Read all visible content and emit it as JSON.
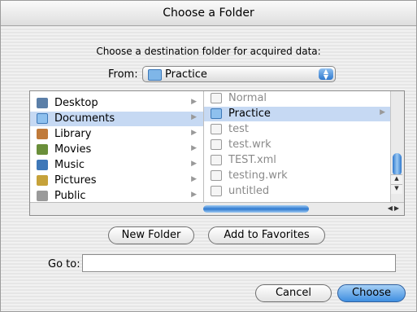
{
  "window": {
    "title": "Choose a Folder"
  },
  "prompt": "Choose a destination folder for acquired data:",
  "from": {
    "label": "From:",
    "selected": "Practice"
  },
  "column1": [
    {
      "label": "Desktop",
      "icon": "desktop-icon",
      "selected": false
    },
    {
      "label": "Documents",
      "icon": "folder-icon",
      "selected": true
    },
    {
      "label": "Library",
      "icon": "library-folder-icon",
      "selected": false
    },
    {
      "label": "Movies",
      "icon": "movies-folder-icon",
      "selected": false
    },
    {
      "label": "Music",
      "icon": "music-folder-icon",
      "selected": false
    },
    {
      "label": "Pictures",
      "icon": "pictures-folder-icon",
      "selected": false
    },
    {
      "label": "Public",
      "icon": "public-folder-icon",
      "selected": false
    }
  ],
  "column2": [
    {
      "label": "Normal",
      "icon": "document-icon",
      "selected": false,
      "dimmed": true
    },
    {
      "label": "Practice",
      "icon": "folder-icon",
      "selected": true,
      "dimmed": false
    },
    {
      "label": "test",
      "icon": "document-icon",
      "selected": false,
      "dimmed": true
    },
    {
      "label": "test.wrk",
      "icon": "document-icon",
      "selected": false,
      "dimmed": true
    },
    {
      "label": "TEST.xml",
      "icon": "document-icon",
      "selected": false,
      "dimmed": true
    },
    {
      "label": "testing.wrk",
      "icon": "document-icon",
      "selected": false,
      "dimmed": true
    },
    {
      "label": "untitled",
      "icon": "document-icon",
      "selected": false,
      "dimmed": true
    }
  ],
  "buttons": {
    "new_folder": "New Folder",
    "add_favorites": "Add to Favorites",
    "cancel": "Cancel",
    "choose": "Choose"
  },
  "goto": {
    "label": "Go to:",
    "value": ""
  },
  "colors": {
    "selection": "#c6d9f3",
    "accent": "#3f8ee0"
  }
}
